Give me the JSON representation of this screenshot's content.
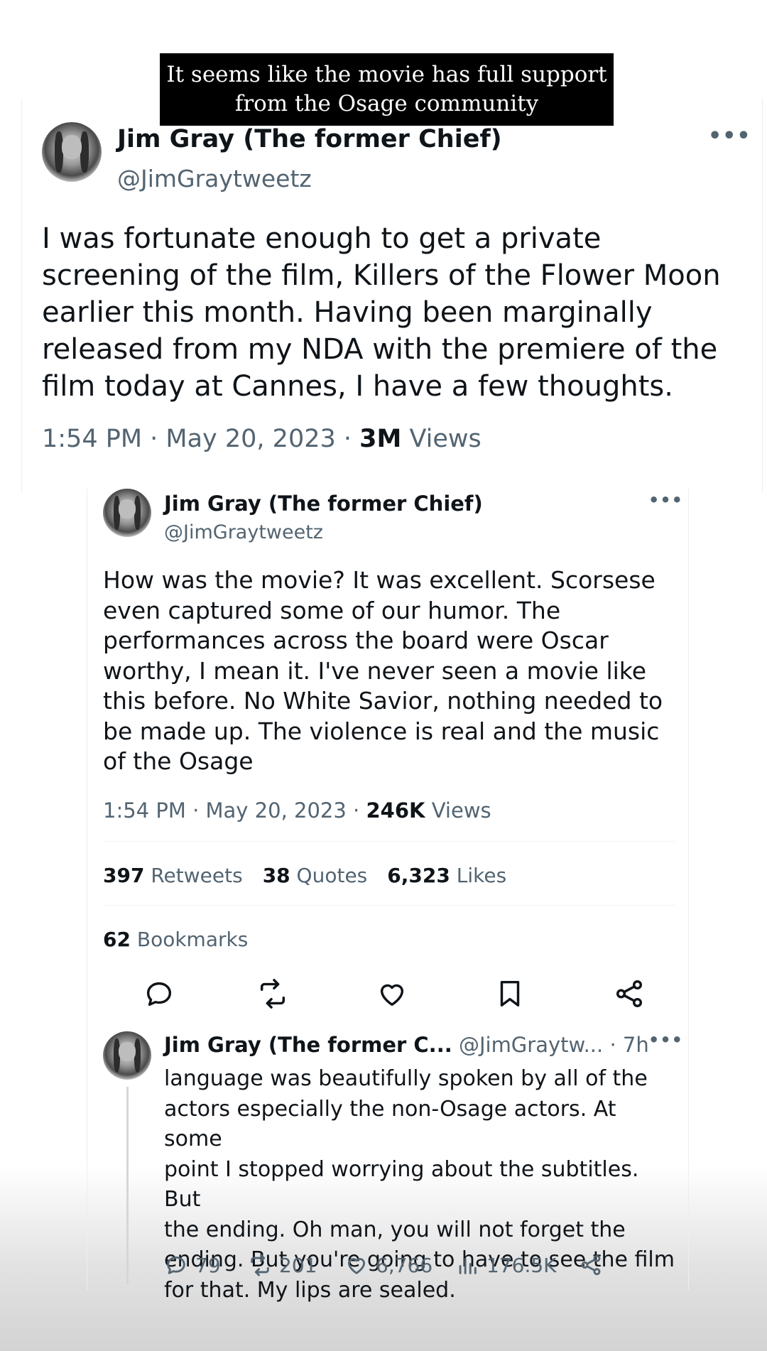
{
  "caption": {
    "line1": "It seems like the movie has full support",
    "line2": "from the Osage community"
  },
  "tweet1": {
    "name": "Jim Gray (The former Chief)",
    "handle": "@JimGraytweetz",
    "more": "•••",
    "body": "I was fortunate enough to get a private\nscreening of the film, Killers of the Flower Moon\nearlier this month. Having been marginally\nreleased from my NDA with the premiere of the\nfilm today at Cannes, I have a few thoughts.",
    "time": "1:54 PM · May 20, 2023 · ",
    "views_count": "3M",
    "views_label": " Views"
  },
  "tweet2": {
    "name": "Jim Gray (The former Chief)",
    "handle": "@JimGraytweetz",
    "more": "•••",
    "body": "How was the movie? It was excellent. Scorsese\neven captured some of our humor. The\nperformances across the board were Oscar\nworthy, I mean it. I've never seen a movie like\nthis before. No White Savior, nothing needed to\nbe made up. The violence is real and the music\nof the Osage",
    "time": "1:54 PM · May 20, 2023 · ",
    "views_count": "246K",
    "views_label": " Views",
    "retweets_count": "397",
    "retweets_label": " Retweets",
    "quotes_count": "38",
    "quotes_label": " Quotes",
    "likes_count": "6,323",
    "likes_label": " Likes",
    "bookmarks_count": "62",
    "bookmarks_label": " Bookmarks"
  },
  "reply": {
    "name": "Jim Gray (The former C...",
    "handle": " @JimGraytw... · 7h",
    "more": "•••",
    "body": "language was beautifully spoken by all of the\nactors especially the non-Osage actors. At some\npoint I stopped worrying about the subtitles. But\nthe ending. Oh man, you will not forget the\nending. But you're going to have to see the film\nfor that. My lips are sealed.",
    "replies": "79",
    "retweets": "201",
    "likes": "6,766",
    "views": "176.5K"
  },
  "icons": [
    "reply-icon",
    "retweet-icon",
    "like-icon",
    "bookmark-icon",
    "share-icon",
    "views-icon",
    "more-icon"
  ],
  "colors": {
    "text": "#0f1419",
    "secondary": "#536471",
    "caption_bg": "#000000"
  }
}
